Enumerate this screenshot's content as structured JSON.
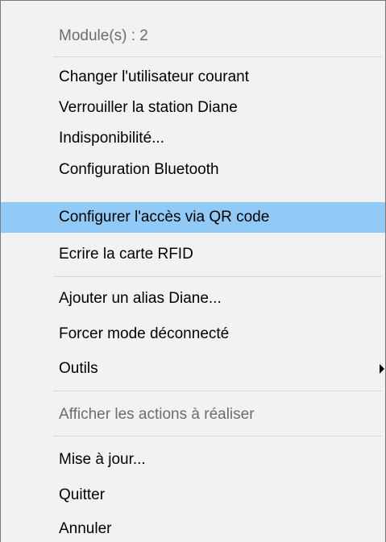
{
  "menu": {
    "header": "Module(s) : 2",
    "items": [
      {
        "label": "Changer l'utilisateur courant"
      },
      {
        "label": "Verrouiller la station Diane"
      },
      {
        "label": "Indisponibilité..."
      },
      {
        "label": "Configuration Bluetooth"
      },
      {
        "label": "Configurer l'accès via QR code"
      },
      {
        "label": "Ecrire la carte RFID"
      },
      {
        "label": "Ajouter un alias Diane..."
      },
      {
        "label": "Forcer mode déconnecté"
      },
      {
        "label": "Outils"
      },
      {
        "label": "Afficher les actions à réaliser"
      },
      {
        "label": "Mise à jour..."
      },
      {
        "label": "Quitter"
      },
      {
        "label": "Annuler"
      }
    ],
    "colors": {
      "highlight": "#91c9f7",
      "background": "#f2f2f2",
      "disabled_text": "#6d6d6d"
    },
    "icons": {
      "submenu": "chevron-right-icon"
    }
  }
}
